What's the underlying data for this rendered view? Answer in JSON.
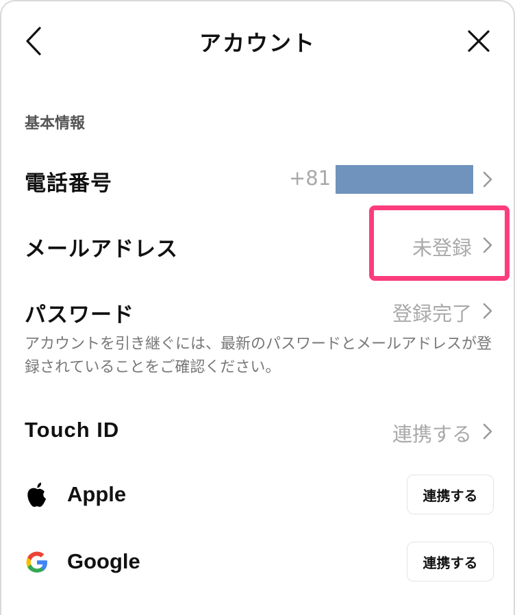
{
  "header": {
    "title": "アカウント",
    "back_icon": "chevron-left-icon",
    "close_icon": "close-icon"
  },
  "section": {
    "label": "基本情報"
  },
  "rows": {
    "phone": {
      "label": "電話番号",
      "value": "+81"
    },
    "email": {
      "label": "メールアドレス",
      "value": "未登録"
    },
    "password": {
      "label": "パスワード",
      "value": "登録完了"
    },
    "touch_id": {
      "label": "Touch ID",
      "value": "連携する"
    }
  },
  "note": "アカウントを引き継ぐには、最新のパスワードとメールアドレスが登録されていることをご確認ください。",
  "sns": {
    "apple": {
      "label": "Apple",
      "button": "連携する",
      "icon": "apple-icon"
    },
    "google": {
      "label": "Google",
      "button": "連携する",
      "icon": "google-icon"
    }
  },
  "colors": {
    "highlight": "#fb3d7d",
    "phone_mask": "#7093bd",
    "value_gray": "#a9a9a9"
  }
}
